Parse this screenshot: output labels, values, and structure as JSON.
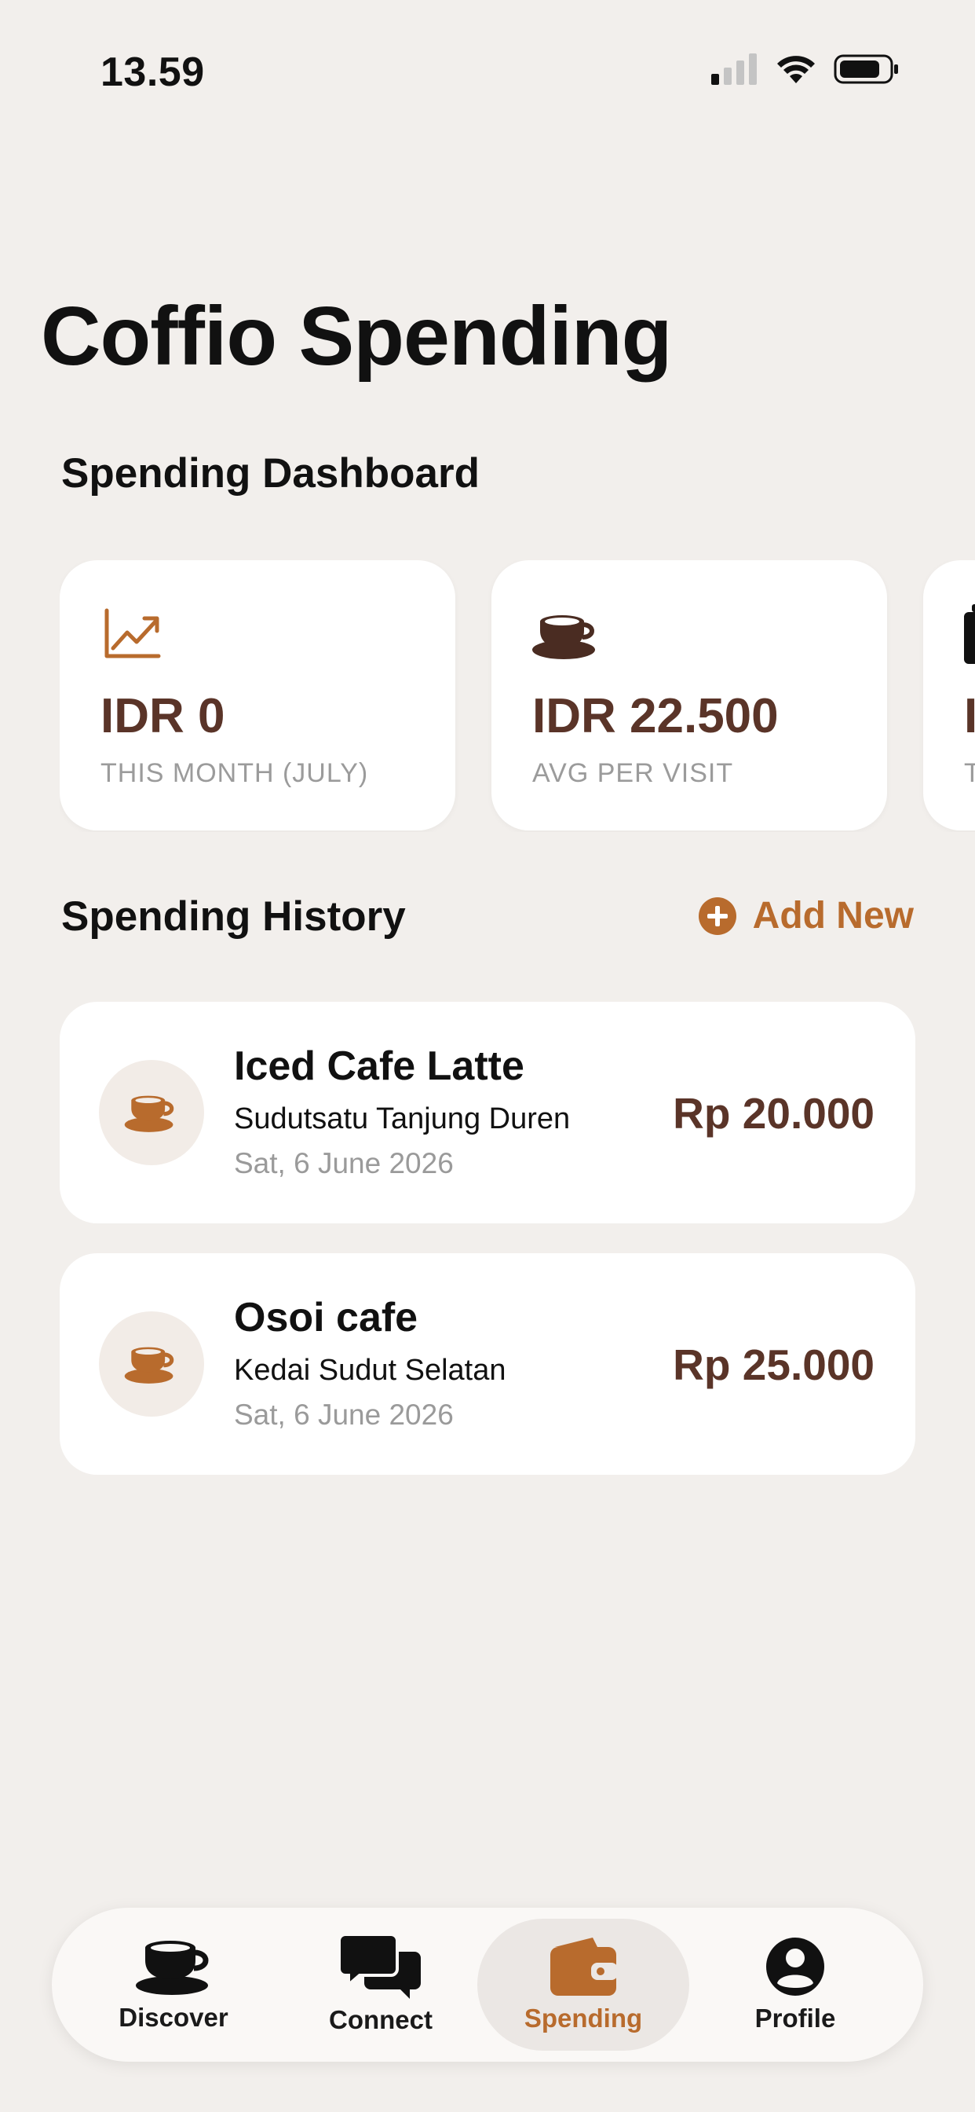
{
  "status_bar": {
    "time": "13.59"
  },
  "header": {
    "title": "Coffio Spending"
  },
  "dashboard": {
    "title": "Spending Dashboard",
    "cards": [
      {
        "value": "IDR 0",
        "caption": "THIS MONTH (JULY)",
        "icon": "chart-line-up-icon"
      },
      {
        "value": "IDR 22.500",
        "caption": "AVG PER VISIT",
        "icon": "coffee-cup-icon"
      },
      {
        "value": "I",
        "caption": "T",
        "icon": "receipt-icon"
      }
    ]
  },
  "history": {
    "title": "Spending History",
    "add_new_label": "Add New",
    "items": [
      {
        "name": "Iced Cafe Latte",
        "location": "Sudutsatu Tanjung Duren",
        "date": "Sat, 6 June 2026",
        "amount": "Rp 20.000"
      },
      {
        "name": "Osoi cafe",
        "location": "Kedai Sudut Selatan",
        "date": "Sat, 6 June 2026",
        "amount": "Rp 25.000"
      }
    ]
  },
  "bottom_nav": {
    "items": [
      {
        "label": "Discover",
        "icon": "coffee-cup-icon",
        "active": false
      },
      {
        "label": "Connect",
        "icon": "chat-bubbles-icon",
        "active": false
      },
      {
        "label": "Spending",
        "icon": "wallet-icon",
        "active": true
      },
      {
        "label": "Profile",
        "icon": "person-circle-icon",
        "active": false
      }
    ]
  },
  "colors": {
    "background": "#f2efec",
    "accent": "#b86b2d",
    "value_brown": "#5a3428",
    "card": "#ffffff"
  }
}
